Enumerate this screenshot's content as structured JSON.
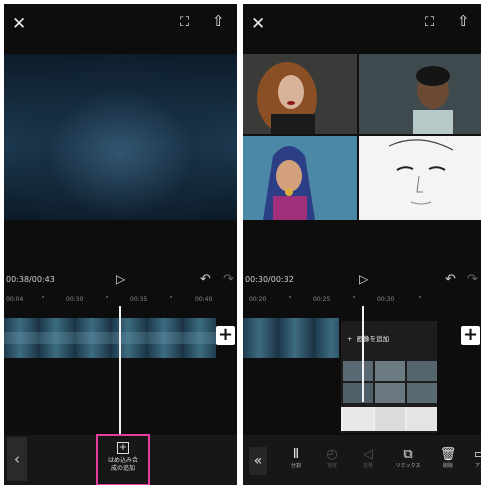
{
  "left": {
    "time": "00:38/00:43",
    "ruler": [
      "00:04",
      "00:30",
      "00:35",
      "00:40"
    ],
    "overlay_button": {
      "line1": "はめ込み合",
      "line2": "成の追加"
    }
  },
  "right": {
    "time": "00:30/00:32",
    "ruler": [
      "00:20",
      "00:25",
      "00:30"
    ],
    "menu_label": "画像を追加",
    "tools": [
      {
        "icon": "split-icon",
        "glyph": "Ⅱ",
        "label": "分割",
        "enabled": true
      },
      {
        "icon": "speed-icon",
        "glyph": "◴",
        "label": "速度",
        "enabled": false
      },
      {
        "icon": "volume-icon",
        "glyph": "◁",
        "label": "音量",
        "enabled": false
      },
      {
        "icon": "remix-icon",
        "glyph": "⧉",
        "label": "リミックス",
        "enabled": true
      },
      {
        "icon": "delete-icon",
        "glyph": "🗑",
        "label": "削除",
        "enabled": true
      },
      {
        "icon": "animation-icon",
        "glyph": "▭",
        "label": "アニ",
        "enabled": true
      }
    ]
  },
  "colors": {
    "accent_highlight": "#e83ca0",
    "background": "#0d0d0d"
  }
}
